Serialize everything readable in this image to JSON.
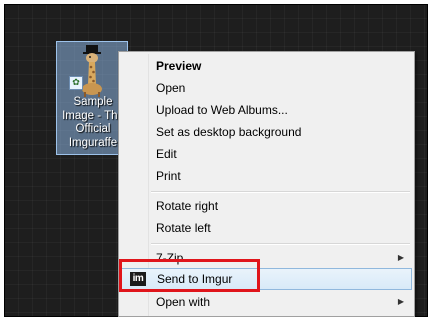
{
  "desktop_icon": {
    "label": "Sample\nImage - The\nOfficial\nImguraffe"
  },
  "context_menu": {
    "items": [
      {
        "label": "Preview",
        "bold": true
      },
      {
        "label": "Open"
      },
      {
        "label": "Upload to Web Albums..."
      },
      {
        "label": "Set as desktop background"
      },
      {
        "label": "Edit"
      },
      {
        "label": "Print"
      },
      {
        "label": "Rotate right"
      },
      {
        "label": "Rotate left"
      },
      {
        "label": "7-Zip",
        "submenu": true
      },
      {
        "label": "Send to Imgur",
        "icon": "imgur-icon",
        "icon_text": "im",
        "highlighted": true
      },
      {
        "label": "Open with",
        "submenu": true
      }
    ]
  },
  "annotation": {
    "color": "#e0151b",
    "target": "Send to Imgur"
  },
  "colors": {
    "desktop_background": "#1e1e1e",
    "menu_background": "#f0f0f0",
    "highlight_border": "#90b8dd"
  }
}
